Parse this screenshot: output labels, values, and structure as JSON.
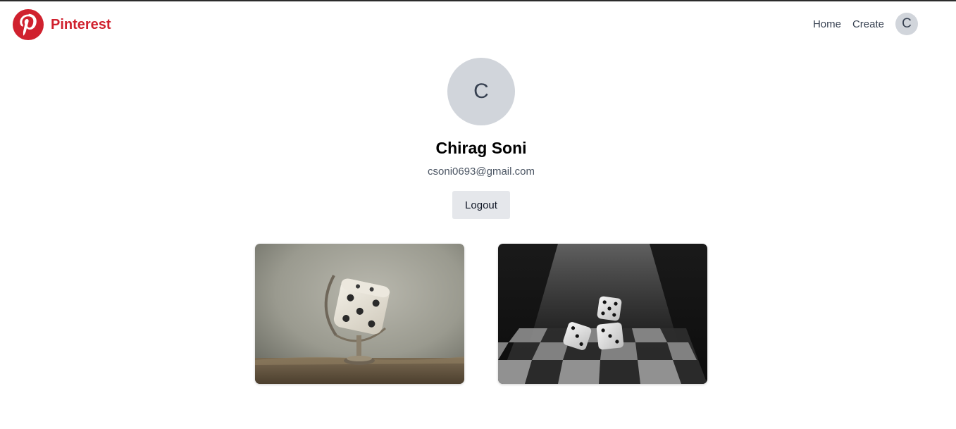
{
  "brand": {
    "name": "Pinterest",
    "logo_icon": "pinterest-logo-icon",
    "color": "#d0212e"
  },
  "nav": {
    "home_label": "Home",
    "create_label": "Create",
    "avatar_initial": "C"
  },
  "profile": {
    "avatar_initial": "C",
    "name": "Chirag Soni",
    "email": "csoni0693@gmail.com",
    "logout_label": "Logout"
  },
  "pins": [
    {
      "image": "dice-globe-image"
    },
    {
      "image": "dice-chessboard-image"
    }
  ]
}
